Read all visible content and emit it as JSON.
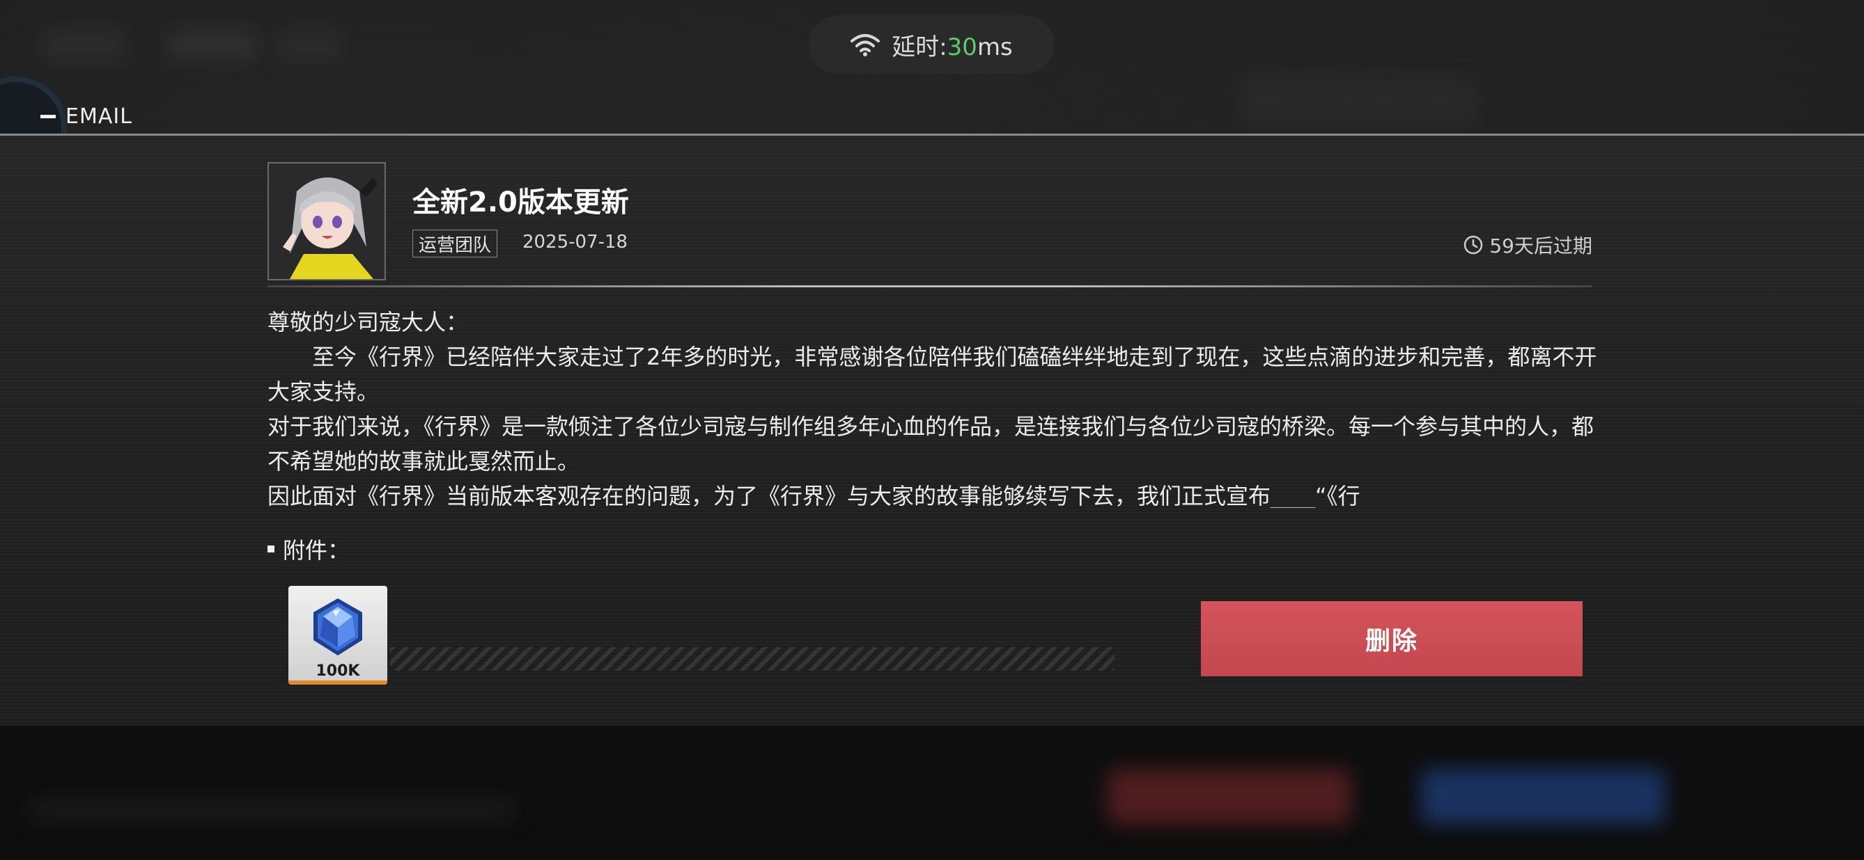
{
  "status_bar": {
    "latency_prefix": "延时:",
    "latency_value": "30",
    "latency_unit": "ms",
    "latency_value_color": "#5ccb6a",
    "icon": "wifi-icon"
  },
  "header": {
    "section_title": "EMAIL"
  },
  "mail": {
    "title": "全新2.0版本更新",
    "sender": "运营团队",
    "date": "2025-07-18",
    "expiry_icon": "clock-icon",
    "expiry_text": "59天后过期",
    "body": [
      "尊敬的少司寇大人：",
      "至今《行界》已经陪伴大家走过了2年多的时光，非常感谢各位陪伴我们磕磕绊绊地走到了现在，这些点滴的进步和完善，都离不开大家支持。",
      "对于我们来说，《行界》是一款倾注了各位少司寇与制作组多年心血的作品，是连接我们与各位少司寇的桥梁。每一个参与其中的人，都不希望她的故事就此戛然而止。",
      "因此面对《行界》当前版本客观存在的问题，为了《行界》与大家的故事能够续写下去，我们正式宣布____“《行"
    ]
  },
  "attachments": {
    "label": "附件：",
    "items": [
      {
        "icon": "blue-crystal-icon",
        "quantity": "100K"
      }
    ]
  },
  "actions": {
    "delete_label": "删除",
    "delete_color": "#cf4f56"
  }
}
